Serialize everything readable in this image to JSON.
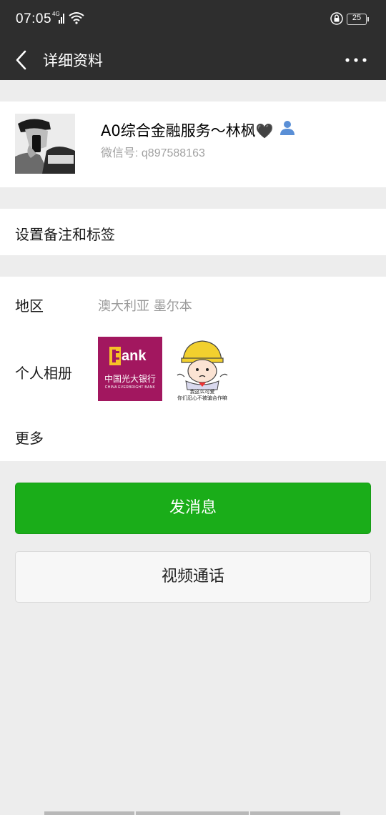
{
  "status_bar": {
    "time": "07:05",
    "network_tag": "4G",
    "battery": "25",
    "icons": [
      "signal-icon",
      "wifi-icon",
      "lock-icon",
      "battery-icon"
    ]
  },
  "nav": {
    "title": "详细资料",
    "back_icon": "chevron-left-icon",
    "more_icon": "more-dots-icon"
  },
  "profile": {
    "name": "A0综合金融服务～林枫",
    "name_suffix": "🖤",
    "wechat_id": "微信号: q897588163",
    "contact_icon": "person-icon"
  },
  "remark": {
    "label": "设置备注和标签"
  },
  "details": {
    "region_label": "地区",
    "region_value": "澳大利亚  墨尔本",
    "album_label": "个人相册",
    "more_label": "更多",
    "album_items": [
      {
        "logo_text": "ank",
        "bank_name": "中国光大银行",
        "bank_en": "CHINA EVERBRIGHT BANK"
      },
      {
        "caption_line1": "我这么可爱",
        "caption_line2": "你们忍心不被骗合作嘛"
      }
    ]
  },
  "actions": {
    "send_message": "发消息",
    "video_call": "视频通话"
  },
  "colors": {
    "nav_background": "#2e2e2e",
    "page_background": "#ededed",
    "primary_green": "#1aad19",
    "secondary_text": "#a2a2a2",
    "bank_purple": "#a2175f"
  }
}
